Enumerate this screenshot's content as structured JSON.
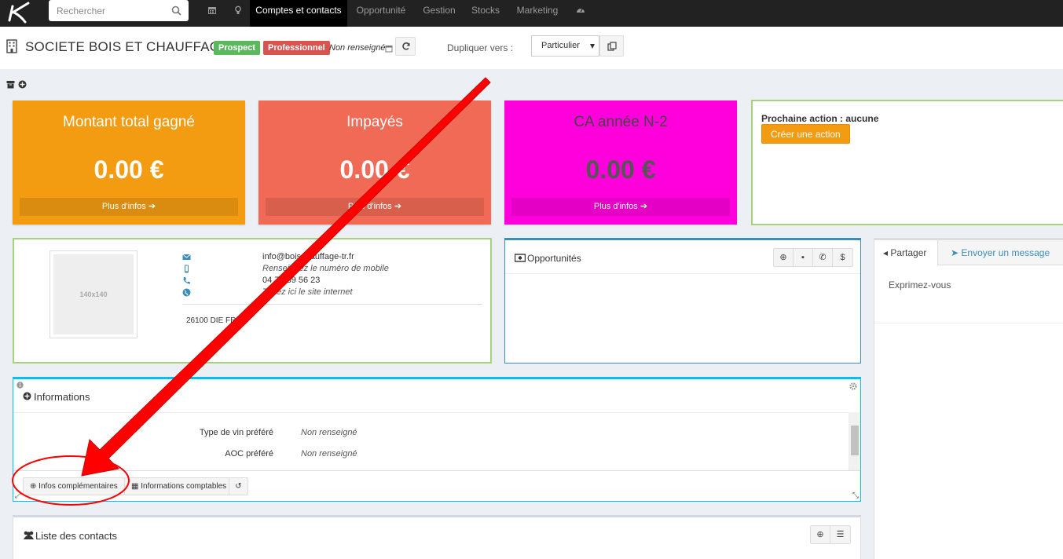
{
  "nav": {
    "search_placeholder": "Rechercher",
    "items": [
      {
        "label": "Comptes et contacts"
      },
      {
        "label": "Opportunité"
      },
      {
        "label": "Gestion"
      },
      {
        "label": "Stocks"
      },
      {
        "label": "Marketing"
      }
    ],
    "icons": [
      "calendar-icon",
      "lightbulb-icon",
      "dashboard-icon"
    ]
  },
  "header": {
    "company_name": "SOCIETE BOIS ET CHAUFFAGE",
    "badge_prospect": "Prospect",
    "badge_pro": "Professionnel",
    "non_renseigne": "Non renseigné",
    "duplicate_label": "Dupliquer vers :",
    "duplicate_selected": "Particulier"
  },
  "stats": [
    {
      "title": "Montant total gagné",
      "value": "0.00 €",
      "more": "Plus d'infos",
      "color": "#f39c12"
    },
    {
      "title": "Impayés",
      "value": "0.00 €",
      "more": "Plus d'infos",
      "color": "#f16a55"
    },
    {
      "title": "CA année N-2",
      "value": "0.00 €",
      "more": "Plus d'infos",
      "color": "#ff00dd"
    }
  ],
  "next_action": {
    "label": "Prochaine action : aucune",
    "button": "Créer une action"
  },
  "contact": {
    "thumb": "140x140",
    "email": "info@boischauffage-tr.fr",
    "mobile": "Renseignez le numéro de mobile",
    "phone": "04 75 89 56 23",
    "website": "Tapez ici le site internet",
    "address": "26100 DIE FR"
  },
  "opportunities": {
    "title": "Opportunités"
  },
  "share": {
    "tab_share": "Partager",
    "tab_message": "Envoyer un message",
    "placeholder": "Exprimez-vous"
  },
  "informations": {
    "title": "Informations",
    "rows": [
      {
        "key": "Type de vin préféré",
        "value": "Non renseigné"
      },
      {
        "key": "AOC préféré",
        "value": "Non renseigné"
      }
    ],
    "btn_extra": "Infos complémentaires",
    "btn_accounting": "Informations comptables"
  },
  "contacts": {
    "title": "Liste des contacts"
  },
  "colors": {
    "annotation_red": "#ff0000",
    "green_border": "#a3d47c",
    "blue_border": "#3c8dbc",
    "cyan_border": "#00c0ef"
  }
}
